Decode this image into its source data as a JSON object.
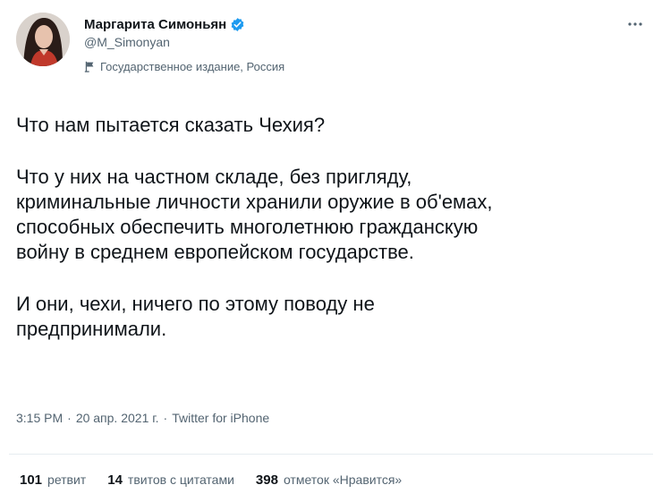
{
  "user": {
    "display_name": "Маргарита Симоньян",
    "handle": "@M_Simonyan",
    "label": "Государственное издание, Россия"
  },
  "tweet": {
    "paragraphs": [
      "Что нам пытается сказать Чехия?",
      "Что у них на частном складе, без пригляду,\nкриминальные личности хранили оружие в об'емах,\nспособных обеспечить многолетнюю гражданскую\nвойну в среднем европейском государстве.",
      "И они, чехи, ничего по этому поводу не\nпредпринимали."
    ],
    "time": "3:15 PM",
    "date": "20 апр. 2021 г.",
    "separator": "·",
    "source": "Twitter for iPhone"
  },
  "stats": {
    "retweets_count": "101",
    "retweets_label": "ретвит",
    "quotes_count": "14",
    "quotes_label": "твитов с цитатами",
    "likes_count": "398",
    "likes_label": "отметок «Нравится»"
  },
  "icons": {
    "verified": "verified-badge-icon",
    "label": "state-media-flag-icon",
    "more": "more-options-icon"
  },
  "colors": {
    "verified_blue": "#1d9bf0",
    "secondary_text": "#536471",
    "primary_text": "#0f1419",
    "divider": "#e6ecf0"
  }
}
